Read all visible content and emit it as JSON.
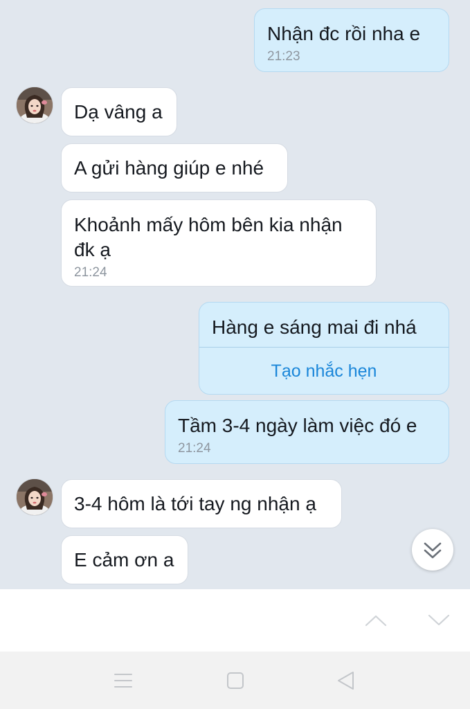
{
  "colors": {
    "chat_background": "#e1e7ee",
    "incoming_bubble": "#ffffff",
    "outgoing_bubble": "#d5eefc",
    "timestamp": "#8e969f",
    "link": "#1a86d9",
    "nav_bar": "#f2f2f2"
  },
  "messages": [
    {
      "direction": "out",
      "text": "Nhận đc rồi nha e",
      "time": "21:23"
    },
    {
      "direction": "in",
      "text": "Dạ vâng a"
    },
    {
      "direction": "in",
      "text": "A gửi hàng giúp e nhé"
    },
    {
      "direction": "in",
      "text": "Khoảnh mấy hôm bên kia nhận\nđk ạ",
      "time": "21:24"
    },
    {
      "direction": "out",
      "text": "Hàng e sáng mai đi nhá",
      "action_label": "Tạo nhắc hẹn"
    },
    {
      "direction": "out",
      "text": "Tầm 3-4 ngày làm việc đó e",
      "time": "21:24"
    },
    {
      "direction": "in",
      "text": "3-4 hôm là tới tay ng nhận ạ"
    },
    {
      "direction": "in",
      "text": "E cảm ơn a"
    }
  ],
  "icons": {
    "avatar": "contact-avatar",
    "scroll_down": "double-chevron-down-icon",
    "search_prev": "chevron-up-icon",
    "search_next": "chevron-down-icon",
    "nav_menu": "menu-icon",
    "nav_home": "square-home-icon",
    "nav_back": "triangle-back-icon"
  }
}
